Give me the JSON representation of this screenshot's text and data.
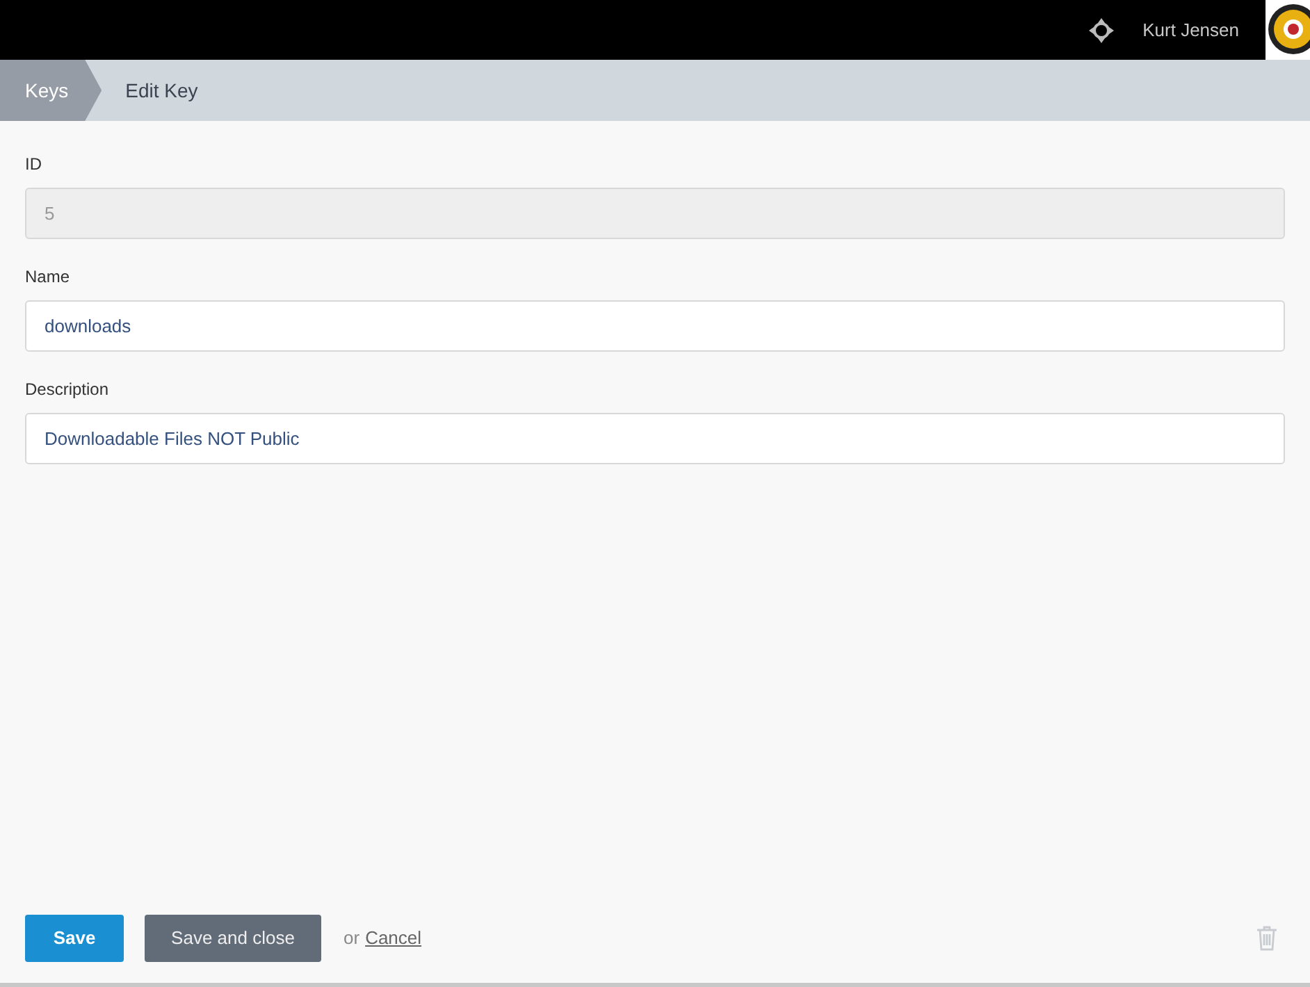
{
  "top_bar": {
    "user_name": "Kurt Jensen"
  },
  "breadcrumbs": [
    {
      "label": "Keys",
      "selected": false
    },
    {
      "label": "Edit Key",
      "selected": true
    }
  ],
  "fields": [
    {
      "label": "ID",
      "value": "5",
      "disabled": true
    },
    {
      "label": "Name",
      "value": "downloads",
      "disabled": false
    },
    {
      "label": "Description",
      "value": "Downloadable Files NOT Public",
      "disabled": false
    }
  ],
  "footer": {
    "save": "Save",
    "save_and_close": "Save and close",
    "or_text": "or",
    "cancel": "Cancel"
  }
}
